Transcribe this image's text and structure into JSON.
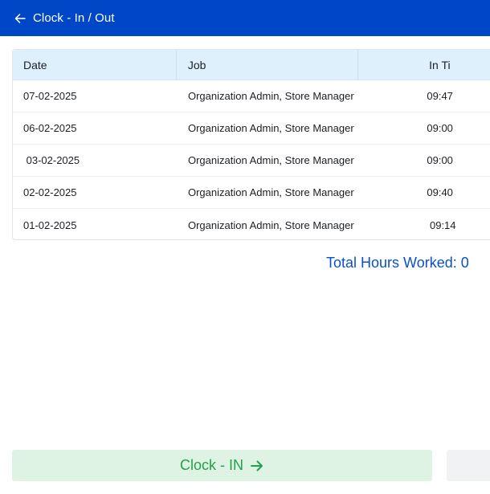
{
  "header": {
    "title": "Clock - In / Out",
    "back_icon": "arrow-left-icon"
  },
  "table": {
    "columns": [
      "Date",
      "Job",
      "In Ti"
    ],
    "rows": [
      {
        "date": "07-02-2025",
        "job": "Organization Admin, Store Manager",
        "in_time": "09:47"
      },
      {
        "date": "06-02-2025",
        "job": "Organization Admin, Store Manager",
        "in_time": "09:00"
      },
      {
        "date": " 03-02-2025",
        "job": "Organization Admin, Store Manager",
        "in_time": "09:00"
      },
      {
        "date": "02-02-2025",
        "job": "Organization Admin, Store Manager",
        "in_time": "09:40"
      },
      {
        "date": "01-02-2025",
        "job": "Organization Admin, Store Manager",
        "in_time": " 09:14"
      }
    ]
  },
  "summary": {
    "total_hours_label": "Total Hours Worked: 0"
  },
  "actions": {
    "clock_in_label": "Clock - IN",
    "clock_in_icon": "arrow-right-icon",
    "clock_out_label": ""
  },
  "colors": {
    "header_bg": "#0047c8",
    "table_header_bg": "#dff0fd",
    "total_text": "#0a4fcf",
    "clock_in_bg": "#dff3e5",
    "clock_in_text": "#23a04a"
  }
}
